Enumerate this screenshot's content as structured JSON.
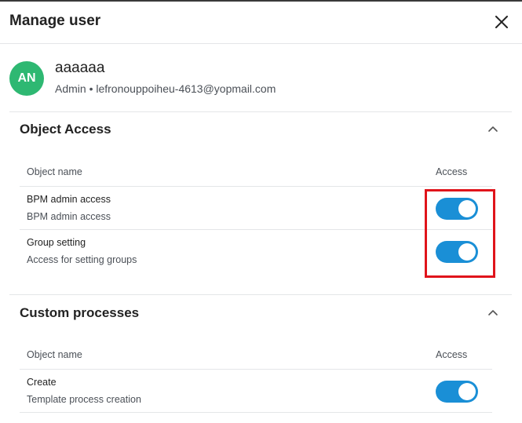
{
  "header": {
    "title": "Manage user",
    "close_icon": "close-icon"
  },
  "user": {
    "initials": "AN",
    "name": "aaaaaa",
    "meta": "Admin • lefronouppoiheu-4613@yopmail.com",
    "avatar_color": "#2eb872"
  },
  "sections": [
    {
      "title": "Object Access",
      "columns": {
        "name": "Object name",
        "access": "Access"
      },
      "rows": [
        {
          "name": "BPM admin access",
          "description": "BPM admin access",
          "enabled": true
        },
        {
          "name": "Group setting",
          "description": "Access for setting groups",
          "enabled": true
        }
      ]
    },
    {
      "title": "Custom processes",
      "columns": {
        "name": "Object name",
        "access": "Access"
      },
      "rows": [
        {
          "name": "Create",
          "description": "Template process creation",
          "enabled": true
        }
      ]
    }
  ],
  "colors": {
    "toggle_on": "#1a8fd6",
    "highlight": "#e0141b"
  }
}
